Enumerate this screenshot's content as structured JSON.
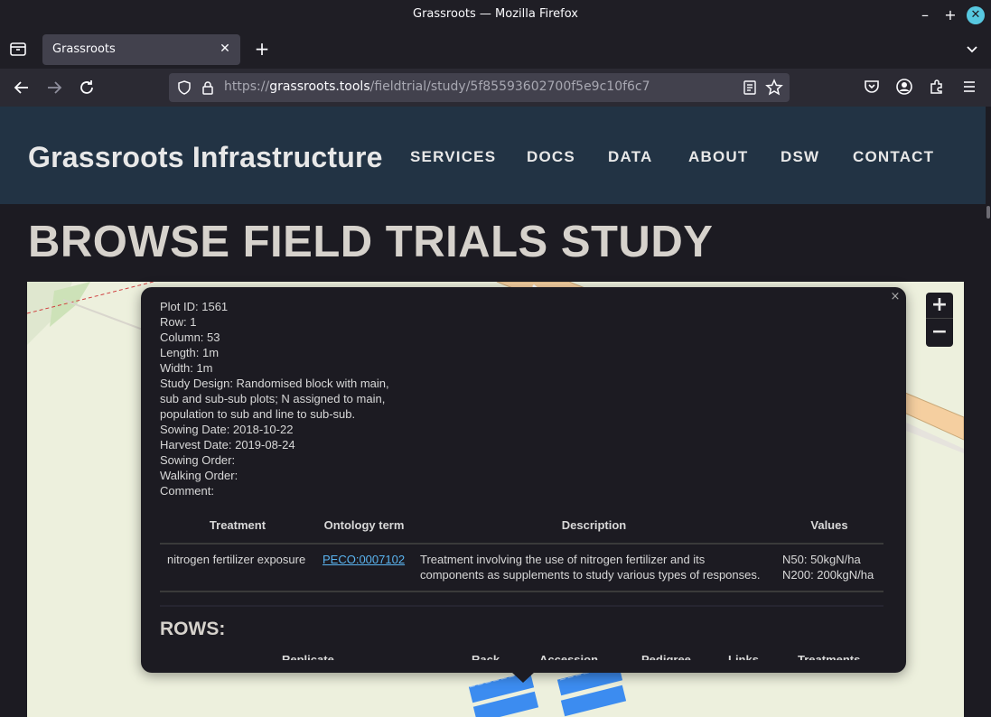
{
  "window": {
    "title": "Grassroots — Mozilla Firefox"
  },
  "tabs": [
    {
      "label": "Grassroots"
    }
  ],
  "address_bar": {
    "url_scheme": "https://",
    "url_host": "grassroots.tools",
    "url_path": "/fieldtrial/study/5f85593602700f5e9c10f6c7"
  },
  "site": {
    "brand": "Grassroots Infrastructure",
    "nav": [
      "SERVICES",
      "DOCS",
      "DATA",
      "ABOUT",
      "DSW",
      "CONTACT"
    ],
    "page_title": "BROWSE FIELD TRIALS STUDY"
  },
  "map": {
    "zoom_in": "+",
    "zoom_out": "−",
    "plot_color": "#3c8cf0"
  },
  "popup": {
    "close": "×",
    "info_lines": [
      "Plot ID: 1561",
      "Row: 1",
      "Column: 53",
      "Length: 1m",
      "Width: 1m",
      "Study Design: Randomised block with main, sub and sub-sub plots; N assigned to main, population to sub and line to sub-sub.",
      "Sowing Date: 2018-10-22",
      "Harvest Date: 2019-08-24",
      "Sowing Order:",
      "Walking Order:",
      "Comment:"
    ],
    "treatment_table": {
      "headers": [
        "Treatment",
        "Ontology term",
        "Description",
        "Values"
      ],
      "rows": [
        {
          "treatment": "nitrogen fertilizer exposure",
          "ontology_term": "PECO:0007102",
          "description": "Treatment involving the use of nitrogen fertilizer and its components as supplements to study various types of responses.",
          "values": [
            "N50: 50kgN/ha",
            "N200: 200kgN/ha"
          ]
        }
      ]
    },
    "rows_title": "ROWS:",
    "rows_headers": [
      "Replicate",
      "Rack",
      "Accession",
      "Pedigree",
      "Links",
      "Treatments"
    ]
  }
}
